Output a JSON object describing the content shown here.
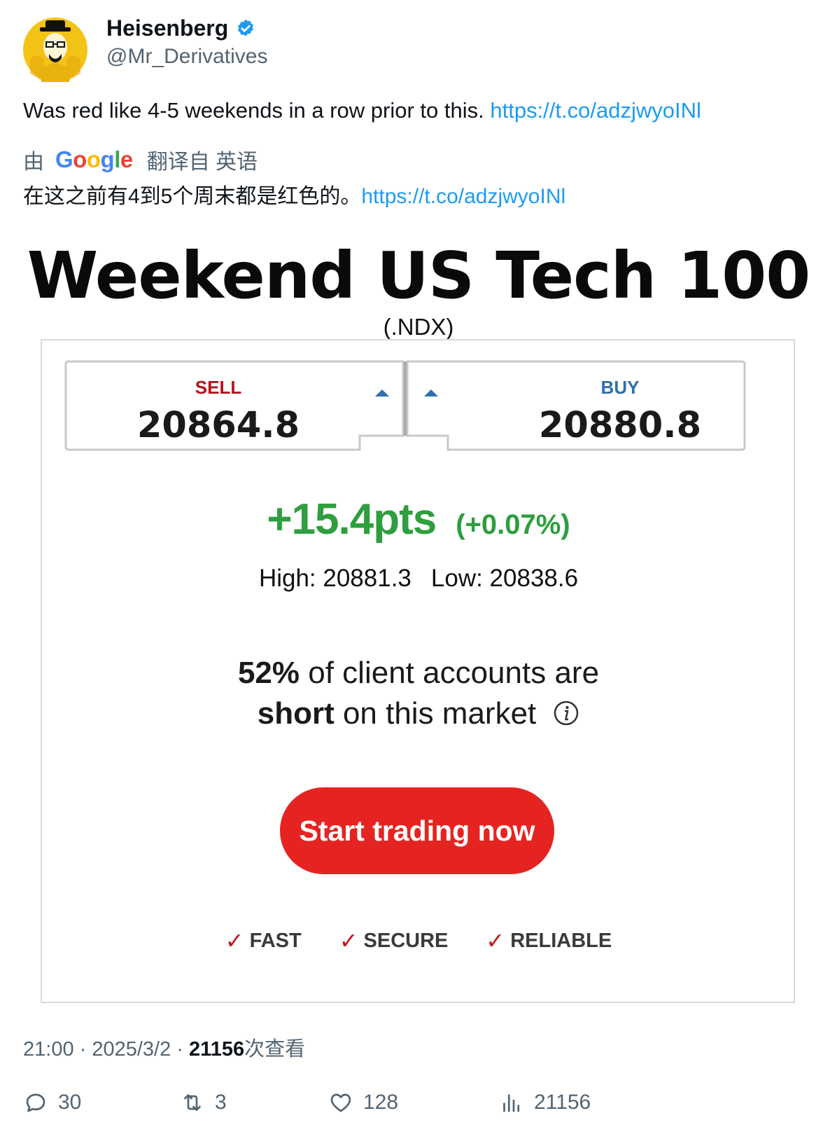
{
  "tweet": {
    "author_name": "Heisenberg",
    "handle": "@Mr_Derivatives",
    "text": "Was red like 4-5 weekends in a row prior to this. ",
    "link": "https://t.co/adzjwyoINl",
    "translation_prefix": "由",
    "translation_suffix": "翻译自 英语",
    "translated_text": "在这之前有4到5个周末都是红色的。",
    "translated_link": "https://t.co/adzjwyoINl"
  },
  "ad": {
    "title": "Weekend US Tech 100",
    "subtitle": "(.NDX)",
    "sell_label": "SELL",
    "sell_value": "20864.8",
    "buy_label": "BUY",
    "buy_value": "20880.8",
    "change_pts": "+15.4pts",
    "change_pct": "(+0.07%)",
    "high": "High: 20881.3",
    "low": "Low: 20838.6",
    "client_pct": "52%",
    "client_line1_rest": " of client accounts are",
    "client_short": "short",
    "client_line2_rest": " on this market",
    "cta_label": "Start trading now",
    "features": [
      "FAST",
      "SECURE",
      "RELIABLE"
    ]
  },
  "meta": {
    "time": "21:00",
    "sep1": " · ",
    "date": "2025/3/2",
    "sep2": " · ",
    "views_count": "21156",
    "views_label": "次查看"
  },
  "actions": {
    "replies": "30",
    "retweets": "3",
    "likes": "128",
    "views": "21156"
  },
  "colors": {
    "link": "#1d9bf0",
    "sell": "#b3151b",
    "buy": "#2f6fae",
    "positive": "#2e9e3e",
    "cta": "#e52421",
    "verified": "#1d9bf0"
  }
}
